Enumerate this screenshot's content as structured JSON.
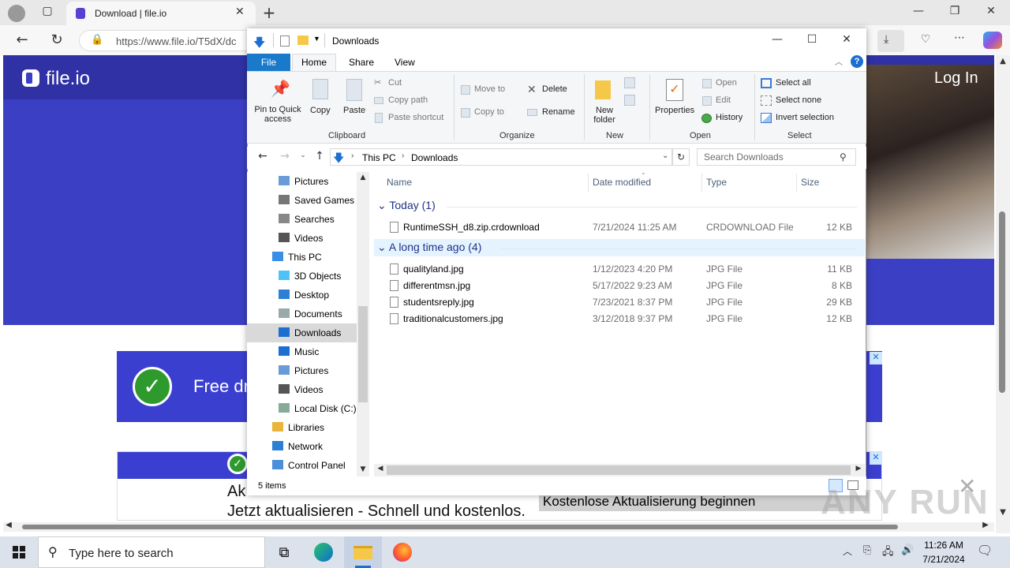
{
  "browser": {
    "tab_title": "Download | file.io",
    "url": "https://www.file.io/T5dX/dc"
  },
  "page": {
    "brand": "file.io",
    "login": "Log In",
    "ad1_text": "Free dr",
    "ad2_line1": "Ak",
    "ad2_line2": "Jetzt aktualisieren - Schnell und kostenlos.",
    "ad2_cta": "Kostenlose Aktualisierung beginnen"
  },
  "explorer": {
    "title": "Downloads",
    "tabs": [
      "File",
      "Home",
      "Share",
      "View"
    ],
    "ribbon": {
      "clipboard": {
        "pin": "Pin to Quick access",
        "copy": "Copy",
        "paste": "Paste",
        "cut": "Cut",
        "copy_path": "Copy path",
        "paste_shortcut": "Paste shortcut",
        "label": "Clipboard"
      },
      "organize": {
        "move_to": "Move to",
        "copy_to": "Copy to",
        "delete": "Delete",
        "rename": "Rename",
        "label": "Organize"
      },
      "new": {
        "new_folder": "New folder",
        "label": "New"
      },
      "open": {
        "properties": "Properties",
        "open": "Open",
        "edit": "Edit",
        "history": "History",
        "label": "Open"
      },
      "select": {
        "select_all": "Select all",
        "select_none": "Select none",
        "invert": "Invert selection",
        "label": "Select"
      }
    },
    "breadcrumb": [
      "This PC",
      "Downloads"
    ],
    "search_placeholder": "Search Downloads",
    "nav": [
      {
        "label": "Pictures",
        "icon": "pictures-icon"
      },
      {
        "label": "Saved Games",
        "icon": "saved-games-icon"
      },
      {
        "label": "Searches",
        "icon": "searches-icon"
      },
      {
        "label": "Videos",
        "icon": "videos-icon"
      },
      {
        "label": "This PC",
        "icon": "this-pc-icon"
      },
      {
        "label": "3D Objects",
        "icon": "3d-objects-icon"
      },
      {
        "label": "Desktop",
        "icon": "desktop-icon"
      },
      {
        "label": "Documents",
        "icon": "documents-icon"
      },
      {
        "label": "Downloads",
        "icon": "downloads-icon"
      },
      {
        "label": "Music",
        "icon": "music-icon"
      },
      {
        "label": "Pictures",
        "icon": "pictures-icon"
      },
      {
        "label": "Videos",
        "icon": "videos-icon"
      },
      {
        "label": "Local Disk (C:)",
        "icon": "drive-icon"
      },
      {
        "label": "Libraries",
        "icon": "libraries-icon"
      },
      {
        "label": "Network",
        "icon": "network-icon"
      },
      {
        "label": "Control Panel",
        "icon": "control-panel-icon"
      }
    ],
    "columns": [
      "Name",
      "Date modified",
      "Type",
      "Size"
    ],
    "groups": [
      {
        "title": "Today (1)",
        "files": [
          {
            "name": "RuntimeSSH_d8.zip.crdownload",
            "date": "7/21/2024 11:25 AM",
            "type": "CRDOWNLOAD File",
            "size": "12 KB"
          }
        ]
      },
      {
        "title": "A long time ago (4)",
        "files": [
          {
            "name": "qualityland.jpg",
            "date": "1/12/2023 4:20 PM",
            "type": "JPG File",
            "size": "11 KB"
          },
          {
            "name": "differentmsn.jpg",
            "date": "5/17/2022 9:23 AM",
            "type": "JPG File",
            "size": "8 KB"
          },
          {
            "name": "studentsreply.jpg",
            "date": "7/23/2021 8:37 PM",
            "type": "JPG File",
            "size": "29 KB"
          },
          {
            "name": "traditionalcustomers.jpg",
            "date": "3/12/2018 9:37 PM",
            "type": "JPG File",
            "size": "12 KB"
          }
        ]
      }
    ],
    "status": "5 items"
  },
  "taskbar": {
    "search_placeholder": "Type here to search",
    "time": "11:26 AM",
    "date": "7/21/2024"
  },
  "watermark": "ANY RUN"
}
